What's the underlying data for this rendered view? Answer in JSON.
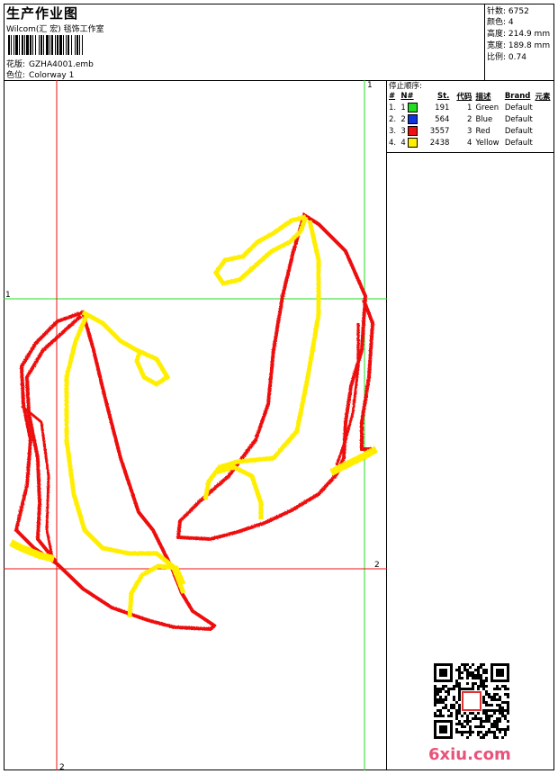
{
  "header": {
    "title": "生产作业图",
    "company": "Wilcom(汇 宏) 毯饰工作室",
    "design_label": "花版:",
    "design_value": "GZHA4001.emb",
    "colorway_label": "色位:",
    "colorway_value": "Colorway 1"
  },
  "stats": {
    "stitches_label": "针数:",
    "stitches_value": "6752",
    "colors_label": "颜色:",
    "colors_value": "4",
    "height_label": "高度:",
    "height_value": "214.9 mm",
    "width_label": "宽度:",
    "width_value": "189.8 mm",
    "scale_label": "比例:",
    "scale_value": "0.74"
  },
  "sequence": {
    "title": "停止顺序:",
    "headers": [
      "#",
      "N#",
      "St.",
      "代码",
      "描述",
      "Brand",
      "元素"
    ],
    "rows": [
      {
        "n": "1.",
        "nn": "1",
        "color": "#22dd22",
        "st": "191",
        "code": "1",
        "desc": "Green",
        "brand": "Default"
      },
      {
        "n": "2.",
        "nn": "2",
        "color": "#1133dd",
        "st": "564",
        "code": "2",
        "desc": "Blue",
        "brand": "Default"
      },
      {
        "n": "3.",
        "nn": "3",
        "color": "#ee1111",
        "st": "3557",
        "code": "3",
        "desc": "Red",
        "brand": "Default"
      },
      {
        "n": "4.",
        "nn": "4",
        "color": "#ffee00",
        "st": "2438",
        "code": "4",
        "desc": "Yellow",
        "brand": "Default"
      }
    ]
  },
  "guides": {
    "green_top": "1",
    "green_left": "1",
    "red_right": "2",
    "red_bottom": "2"
  },
  "colors": {
    "green": "#22dd22",
    "red": "#ee1111",
    "yellow": "#ffee00",
    "blue": "#2233cc",
    "site_pink": "#e8537a"
  },
  "footer": {
    "site": "6xiu.com"
  }
}
